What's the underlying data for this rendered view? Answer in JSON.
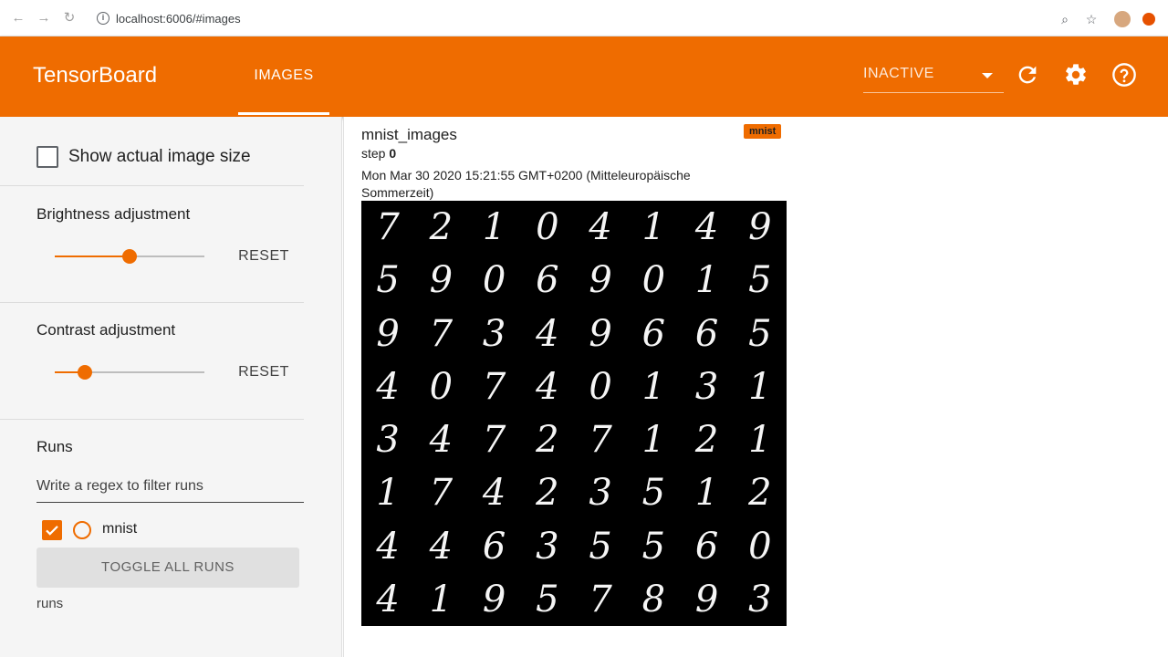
{
  "browser": {
    "url": "localhost:6006/#images"
  },
  "header": {
    "app_title": "TensorBoard",
    "tab_label": "IMAGES",
    "status_select": "INACTIVE"
  },
  "sidebar": {
    "show_actual_size_label": "Show actual image size",
    "brightness": {
      "title": "Brightness adjustment",
      "value": 0.5,
      "reset_label": "RESET"
    },
    "contrast": {
      "title": "Contrast adjustment",
      "value": 0.2,
      "reset_label": "RESET"
    },
    "runs": {
      "title": "Runs",
      "filter_placeholder": "Write a regex to filter runs",
      "items": [
        {
          "name": "mnist",
          "checked": true
        }
      ],
      "toggle_label": "TOGGLE ALL RUNS",
      "footer": "runs"
    }
  },
  "card": {
    "title": "mnist_images",
    "run_badge": "mnist",
    "step_label": "step",
    "step_value": "0",
    "timestamp": "Mon Mar 30 2020 15:21:55 GMT+0200 (Mitteleuropäische Sommerzeit)",
    "digits": [
      "7",
      "2",
      "1",
      "0",
      "4",
      "1",
      "4",
      "9",
      "5",
      "9",
      "0",
      "6",
      "9",
      "0",
      "1",
      "5",
      "9",
      "7",
      "3",
      "4",
      "9",
      "6",
      "6",
      "5",
      "4",
      "0",
      "7",
      "4",
      "0",
      "1",
      "3",
      "1",
      "3",
      "4",
      "7",
      "2",
      "7",
      "1",
      "2",
      "1",
      "1",
      "7",
      "4",
      "2",
      "3",
      "5",
      "1",
      "2",
      "4",
      "4",
      "6",
      "3",
      "5",
      "5",
      "6",
      "0",
      "4",
      "1",
      "9",
      "5",
      "7",
      "8",
      "9",
      "3"
    ]
  },
  "colors": {
    "accent": "#ef6c00"
  }
}
